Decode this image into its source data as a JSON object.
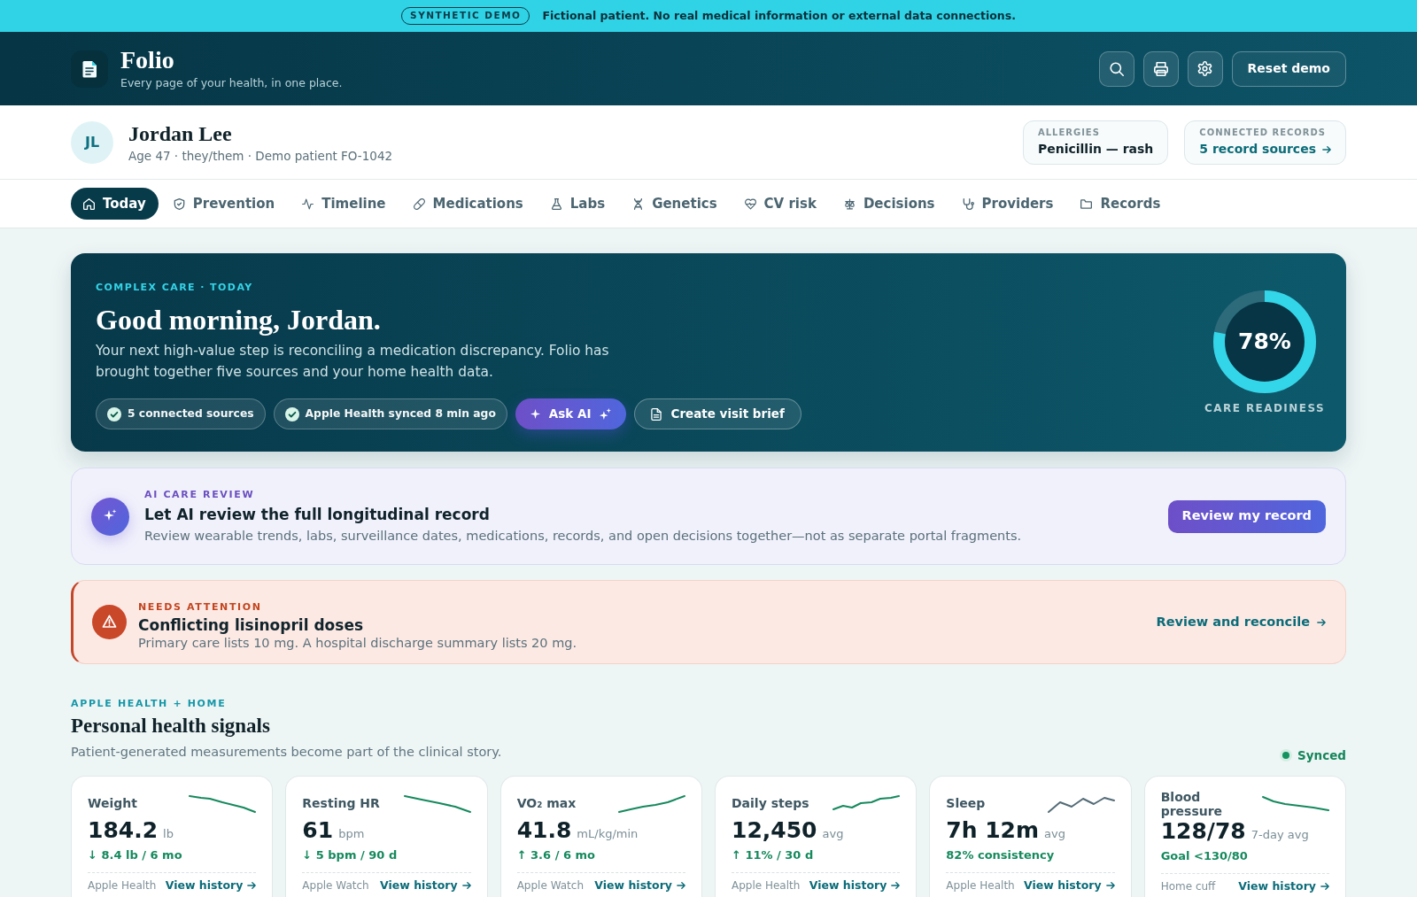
{
  "banner": {
    "badge": "SYNTHETIC DEMO",
    "message": "Fictional patient. No real medical information or external data connections."
  },
  "header": {
    "app_name": "Folio",
    "tagline": "Every page of your health, in one place.",
    "reset_button": "Reset demo"
  },
  "patient": {
    "initials": "JL",
    "name": "Jordan Lee",
    "details": "Age 47 · they/them · Demo patient FO-1042",
    "allergies": {
      "label": "ALLERGIES",
      "value": "Penicillin — rash"
    },
    "connected_records": {
      "label": "CONNECTED RECORDS",
      "link": "5 record sources"
    }
  },
  "tabs": [
    {
      "label": "Today",
      "selected": true
    },
    {
      "label": "Prevention",
      "selected": false
    },
    {
      "label": "Timeline",
      "selected": false
    },
    {
      "label": "Medications",
      "selected": false
    },
    {
      "label": "Labs",
      "selected": false
    },
    {
      "label": "Genetics",
      "selected": false
    },
    {
      "label": "CV risk",
      "selected": false
    },
    {
      "label": "Decisions",
      "selected": false
    },
    {
      "label": "Providers",
      "selected": false
    },
    {
      "label": "Records",
      "selected": false
    }
  ],
  "hero": {
    "eyebrow": "COMPLEX CARE · TODAY",
    "title": "Good morning, Jordan.",
    "body": "Your next high-value step is reconciling a medication discrepancy. Folio has brought together five sources and your home health data.",
    "chips": [
      {
        "kind": "status",
        "label": "5 connected sources"
      },
      {
        "kind": "status",
        "label": "Apple Health synced 8 min ago"
      },
      {
        "kind": "ai",
        "label": "Ask AI"
      },
      {
        "kind": "outline",
        "label": "Create visit brief"
      }
    ],
    "readiness": {
      "reading": "78%",
      "level": 0.78,
      "label": "CARE READINESS"
    }
  },
  "ai_review": {
    "eyebrow": "AI CARE REVIEW",
    "title": "Let AI review the full longitudinal record",
    "body": "Review wearable trends, labs, surveillance dates, medications, records, and open decisions together—not as separate portal fragments.",
    "button": "Review my record"
  },
  "alert": {
    "eyebrow": "NEEDS ATTENTION",
    "title": "Conflicting lisinopril doses",
    "body": "Primary care lists 10 mg. A hospital discharge summary lists 20 mg.",
    "link": "Review and reconcile"
  },
  "signals": {
    "eyebrow": "APPLE HEALTH + HOME",
    "title": "Personal health signals",
    "subtitle": "Patient-generated measurements become part of the clinical story.",
    "sync_status": "Synced",
    "cards": [
      {
        "name": "Weight",
        "value": "184.2",
        "unit": "lb",
        "change": "↓ 8.4 lb / 6 mo",
        "source": "Apple Health",
        "link": "View history"
      },
      {
        "name": "Resting HR",
        "value": "61",
        "unit": "bpm",
        "change": "↓ 5 bpm / 90 d",
        "source": "Apple Watch",
        "link": "View history"
      },
      {
        "name": "VO₂ max",
        "value": "41.8",
        "unit": "mL/kg/min",
        "change": "↑ 3.6 / 6 mo",
        "source": "Apple Watch",
        "link": "View history"
      },
      {
        "name": "Daily steps",
        "value": "12,450",
        "unit": "avg",
        "change": "↑ 11% / 30 d",
        "source": "Apple Health",
        "link": "View history"
      },
      {
        "name": "Sleep",
        "value": "7h 12m",
        "unit": "avg",
        "change": "82% consistency",
        "source": "Apple Health",
        "link": "View history"
      },
      {
        "name": "Blood pressure",
        "value": "128/78",
        "unit": "7-day avg",
        "change": "Goal <130/80",
        "source": "Home cuff",
        "link": "View history"
      }
    ]
  }
}
